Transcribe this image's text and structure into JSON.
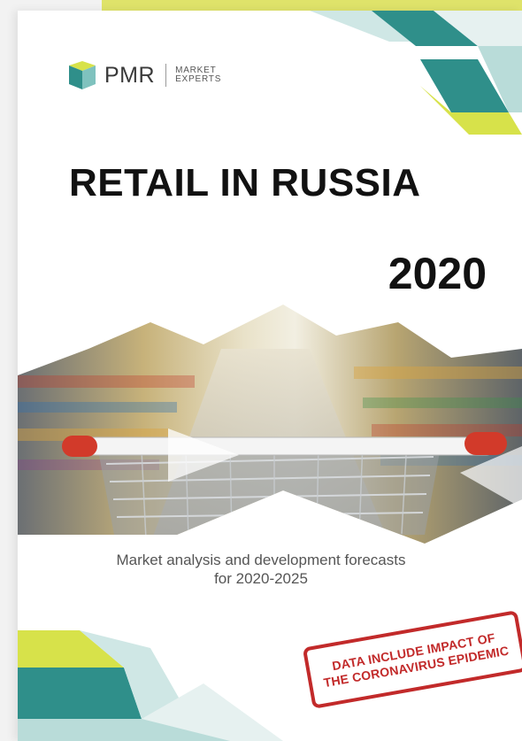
{
  "brand": {
    "logo_text": "PMR",
    "tagline": "MARKET\nEXPERTS"
  },
  "cover": {
    "title": "RETAIL IN RUSSIA",
    "year": "2020",
    "subtitle_line1": "Market analysis and development forecasts",
    "subtitle_line2": "for 2020-2025"
  },
  "stamp": {
    "line1": "DATA INCLUDE IMPACT OF",
    "line2": "THE CORONAVIRUS EPIDEMIC"
  },
  "colors": {
    "teal": "#2f8f8a",
    "light_teal": "#9fd2cf",
    "lime": "#d7e24a",
    "stamp_red": "#c22a2a"
  }
}
